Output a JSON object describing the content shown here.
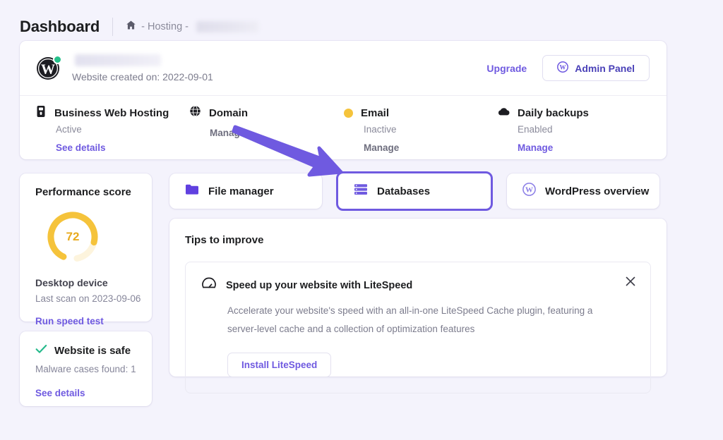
{
  "header": {
    "title": "Dashboard",
    "breadcrumb": {
      "home_icon": "home-icon",
      "text": "- Hosting -",
      "redacted_domain": ""
    }
  },
  "hero": {
    "site_icon": "wordpress-icon",
    "status_dot_color": "#26c08a",
    "redacted_site_name": "",
    "created_label": "Website created on: 2022-09-01",
    "upgrade_label": "Upgrade",
    "admin_panel_label": "Admin Panel",
    "admin_panel_icon": "wordpress-icon"
  },
  "services": [
    {
      "icon": "server-icon",
      "name": "Business Web Hosting",
      "status": "Active",
      "action": "See details",
      "action_active": true
    },
    {
      "icon": "globe-icon",
      "name": "Domain",
      "status": "",
      "action": "Manage",
      "action_active": false
    },
    {
      "icon": "warning-dot-icon",
      "name": "Email",
      "status": "Inactive",
      "action": "Manage",
      "action_active": false
    },
    {
      "icon": "cloud-icon",
      "name": "Daily backups",
      "status": "Enabled",
      "action": "Manage",
      "action_active": true
    }
  ],
  "performance": {
    "title": "Performance score",
    "score": 72,
    "score_max": 100,
    "gauge_color": "#f5c33b",
    "gauge_track_color": "#fdf4dd",
    "device": "Desktop device",
    "last_scan": "Last scan on 2023-09-06",
    "action": "Run speed test"
  },
  "safety": {
    "icon": "check-icon",
    "icon_color": "#23b98a",
    "title": "Website is safe",
    "subtitle": "Malware cases found: 1",
    "action": "See details"
  },
  "tiles": [
    {
      "icon": "folder-icon",
      "label": "File manager",
      "selected": false
    },
    {
      "icon": "database-icon",
      "label": "Databases",
      "selected": true
    },
    {
      "icon": "wordpress-icon",
      "label": "WordPress overview",
      "selected": false
    }
  ],
  "tips": {
    "title": "Tips to improve",
    "items": [
      {
        "icon": "speedometer-icon",
        "title": "Speed up your website with LiteSpeed",
        "body": "Accelerate your website's speed with an all-in-one LiteSpeed Cache plugin, featuring a server-level cache and a collection of optimization features",
        "button": "Install LiteSpeed",
        "close_icon": "close-icon"
      }
    ]
  },
  "annotation": {
    "type": "arrow",
    "color": "#6f5ae0",
    "points_to": "Databases"
  },
  "theme": {
    "background": "#f4f3fc",
    "accent": "#6f5ae0",
    "card": "#ffffff"
  }
}
